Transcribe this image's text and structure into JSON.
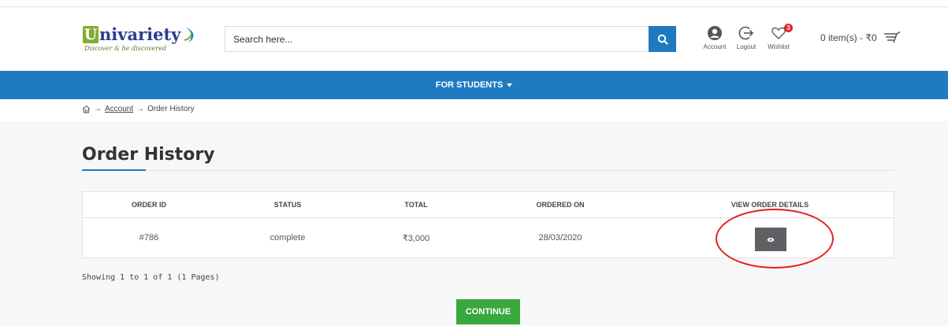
{
  "logo": {
    "letter": "U",
    "text": "nivariety",
    "tagline": "Discover & be discovered"
  },
  "search": {
    "placeholder": "Search here..."
  },
  "header_icons": {
    "account": "Account",
    "logout": "Logout",
    "wishlist": "Wishlist",
    "wishlist_count": "3"
  },
  "cart": {
    "summary": "0 item(s) - ₹0"
  },
  "nav": {
    "menu_label": "FOR STUDENTS"
  },
  "breadcrumb": {
    "account": "Account",
    "current": "Order History"
  },
  "page": {
    "title": "Order History"
  },
  "table": {
    "headers": {
      "order_id": "ORDER ID",
      "status": "STATUS",
      "total": "TOTAL",
      "ordered_on": "ORDERED ON",
      "view": "VIEW ORDER DETAILS"
    },
    "rows": [
      {
        "order_id": "#786",
        "status": "complete",
        "total": "₹3,000",
        "ordered_on": "28/03/2020"
      }
    ]
  },
  "pagination": {
    "text": "Showing 1 to 1 of 1 (1 Pages)"
  },
  "actions": {
    "continue": "CONTINUE"
  },
  "colors": {
    "brand_blue": "#1f7bc1",
    "continue_green": "#38a83f",
    "annotation_red": "#e0221f",
    "badge_red": "#e4202e"
  },
  "icons": [
    "search-icon",
    "account-icon",
    "logout-icon",
    "heart-icon",
    "cart-icon",
    "home-icon",
    "eye-icon",
    "caret-down-icon"
  ]
}
